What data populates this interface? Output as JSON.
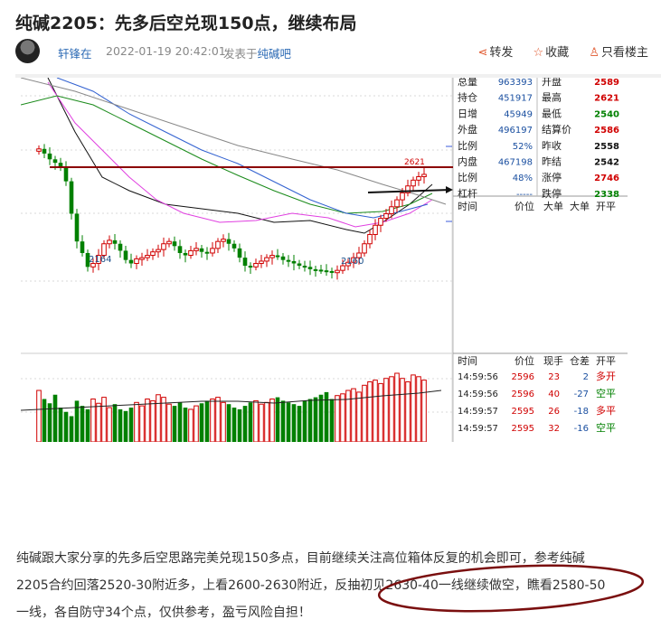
{
  "post": {
    "title": "纯碱2205：先多后空兑现150点，继续布局",
    "author": "轩锋在",
    "timestamp": "2022-01-19 20:42:01",
    "posted_in_prefix": "发表于",
    "bar_name": "纯碱吧",
    "actions": {
      "share": "转发",
      "favorite": "收藏",
      "only_op": "只看楼主"
    },
    "body_lines": [
      "纯碱跟大家分享的先多后空思路完美兑现150多点，目前继续关注高位箱体反复的机会即可，参考纯碱",
      "2205合约回落2520-30附近多，上看2600-2630附近，反抽初见2630-40一线继续做空，瞧看2580-50",
      "一线，各自防守34个点，仅供参考，盈亏风险自担！"
    ]
  },
  "quote_panel": {
    "left": [
      {
        "label": "总量",
        "value": "963393"
      },
      {
        "label": "持仓",
        "value": "451917"
      },
      {
        "label": "日增",
        "value": "45949"
      },
      {
        "label": "外盘",
        "value": "496197"
      },
      {
        "label": "比例",
        "value": "52%"
      },
      {
        "label": "内盘",
        "value": "467198"
      },
      {
        "label": "比例",
        "value": "48%"
      },
      {
        "label": "杠杆",
        "value": "-----"
      }
    ],
    "right": [
      {
        "label": "开盘",
        "value": "2589",
        "color": "#d00000"
      },
      {
        "label": "最高",
        "value": "2621",
        "color": "#d00000"
      },
      {
        "label": "最低",
        "value": "2540",
        "color": "#008000"
      },
      {
        "label": "结算价",
        "value": "2586",
        "color": "#d00000"
      },
      {
        "label": "昨收",
        "value": "2558",
        "color": "#111111"
      },
      {
        "label": "昨结",
        "value": "2542",
        "color": "#111111"
      },
      {
        "label": "涨停",
        "value": "2746",
        "color": "#d00000"
      },
      {
        "label": "跌停",
        "value": "2338",
        "color": "#008000"
      }
    ],
    "tick_header": [
      "时间",
      "价位",
      "大单",
      "大单",
      "开平"
    ],
    "tick_header2": [
      "时间",
      "价位",
      "现手",
      "仓差",
      "开平"
    ],
    "ticks": [
      {
        "time": "14:59:56",
        "price": "2596",
        "vol": "23",
        "oi": "2",
        "type": "多开",
        "type_color": "#d00000"
      },
      {
        "time": "14:59:56",
        "price": "2596",
        "vol": "40",
        "oi": "-27",
        "type": "空平",
        "type_color": "#008000"
      },
      {
        "time": "14:59:57",
        "price": "2595",
        "vol": "26",
        "oi": "-18",
        "type": "多平",
        "type_color": "#d00000"
      },
      {
        "time": "14:59:57",
        "price": "2595",
        "vol": "32",
        "oi": "-16",
        "type": "空平",
        "type_color": "#008000"
      }
    ]
  },
  "chart_data": {
    "type": "candlestick",
    "annotations": [
      "2164",
      "2160",
      "2621"
    ],
    "resistance_level": 2621,
    "colors": {
      "up": "#d00000",
      "down": "#008000",
      "resistance_line": "#8b0000"
    }
  }
}
